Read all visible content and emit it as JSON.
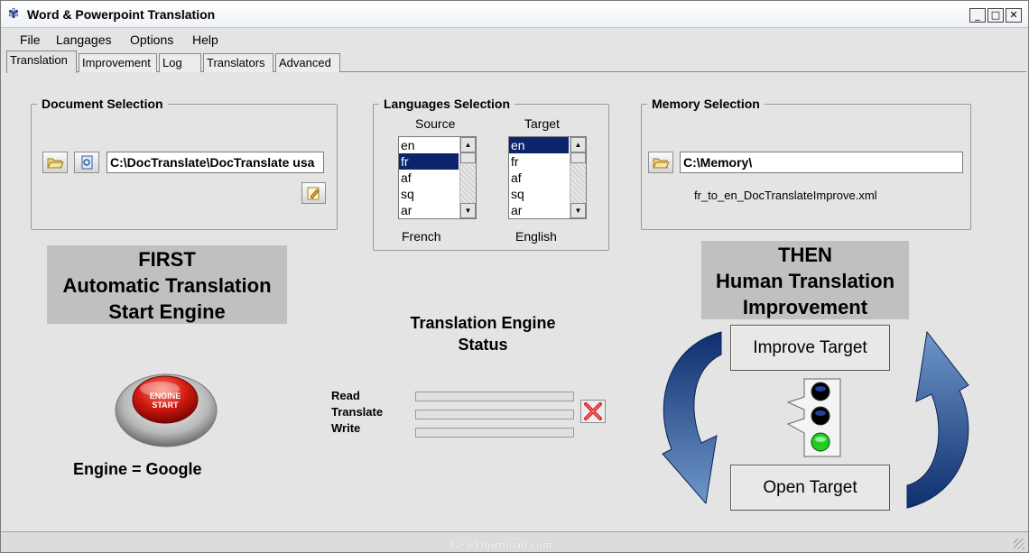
{
  "window": {
    "title": "Word & Powerpoint Translation",
    "controls": {
      "minimize": "_",
      "maximize": "□",
      "close": "✕"
    }
  },
  "menu": [
    "File",
    "Langages",
    "Options",
    "Help"
  ],
  "tabs": [
    {
      "label": "Translation",
      "active": true
    },
    {
      "label": "Improvement",
      "active": false
    },
    {
      "label": "Log",
      "active": false
    },
    {
      "label": "Translators",
      "active": false
    },
    {
      "label": "Advanced",
      "active": false
    }
  ],
  "document_selection": {
    "title": "Document Selection",
    "path_value": "C:\\DocTranslate\\DocTranslate usa",
    "icons": [
      "open-folder-icon",
      "preview-icon",
      "edit-icon"
    ]
  },
  "languages_selection": {
    "title": "Languages Selection",
    "source_header": "Source",
    "target_header": "Target",
    "source_options": [
      "en",
      "fr",
      "af",
      "sq",
      "ar"
    ],
    "source_selected": "fr",
    "target_options": [
      "en",
      "fr",
      "af",
      "sq",
      "ar"
    ],
    "target_selected": "en",
    "source_name": "French",
    "target_name": "English"
  },
  "memory_selection": {
    "title": "Memory Selection",
    "path_value": "C:\\Memory\\",
    "file_name": "fr_to_en_DocTranslateImprove.xml"
  },
  "first_banner": {
    "line1": "FIRST",
    "line2": "Automatic Translation",
    "line3": "Start Engine"
  },
  "then_banner": {
    "line1": "THEN",
    "line2": "Human Translation",
    "line3": "Improvement"
  },
  "engine": {
    "button_text_line1": "ENGINE",
    "button_text_line2": "START",
    "label": "Engine = Google"
  },
  "status": {
    "title_line1": "Translation Engine",
    "title_line2": "Status",
    "rows": [
      {
        "label": "Read",
        "progress": 0
      },
      {
        "label": "Translate",
        "progress": 0
      },
      {
        "label": "Write",
        "progress": 0
      }
    ],
    "cancel_icon": "red-x-icon"
  },
  "improvement": {
    "improve_button": "Improve Target",
    "open_button": "Open Target",
    "traffic_light": [
      "off",
      "off",
      "green"
    ]
  },
  "footer": {
    "watermark": "GearDownload.com"
  },
  "colors": {
    "selection": "#0b246a",
    "arrow": "#1f4c8f",
    "light_on": "#22cc22",
    "banner": "#c0c0c0"
  }
}
